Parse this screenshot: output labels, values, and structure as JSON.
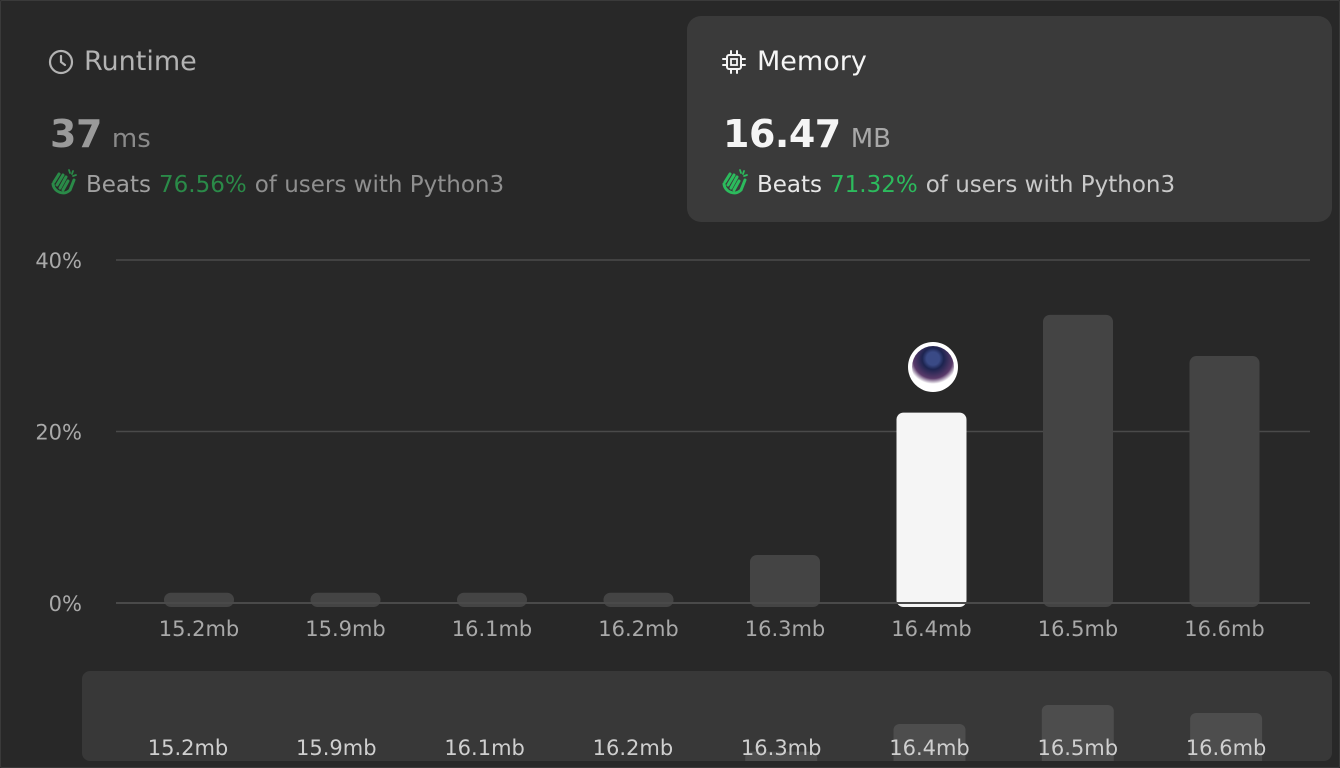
{
  "runtime": {
    "title": "Runtime",
    "value": "37",
    "unit": "ms",
    "beats_label": "Beats",
    "beats_pct": "76.56%",
    "beats_suffix": "of users with Python3",
    "icon": "clock-icon"
  },
  "memory": {
    "title": "Memory",
    "value": "16.47",
    "unit": "MB",
    "beats_label": "Beats",
    "beats_pct": "71.32%",
    "beats_suffix": "of users with Python3",
    "icon": "chip-icon"
  },
  "colors": {
    "background": "#282828",
    "card_active": "#3a3a3a",
    "bar": "#444444",
    "bar_highlight": "#f5f5f5",
    "green": "#2cbb5d"
  },
  "chart_data": {
    "type": "bar",
    "categories": [
      "15.2mb",
      "15.9mb",
      "16.1mb",
      "16.2mb",
      "16.3mb",
      "16.4mb",
      "16.5mb",
      "16.6mb"
    ],
    "values": [
      1.2,
      1.2,
      1.2,
      1.2,
      5.6,
      22.2,
      33.6,
      28.8
    ],
    "highlight_category": "16.4mb",
    "yticks": [
      "0%",
      "20%",
      "40%"
    ],
    "ylim": [
      0,
      40
    ],
    "grid": true,
    "overview": {
      "categories": [
        "15.2mb",
        "15.9mb",
        "16.1mb",
        "16.2mb",
        "16.3mb",
        "16.4mb",
        "16.5mb",
        "16.6mb"
      ]
    }
  }
}
